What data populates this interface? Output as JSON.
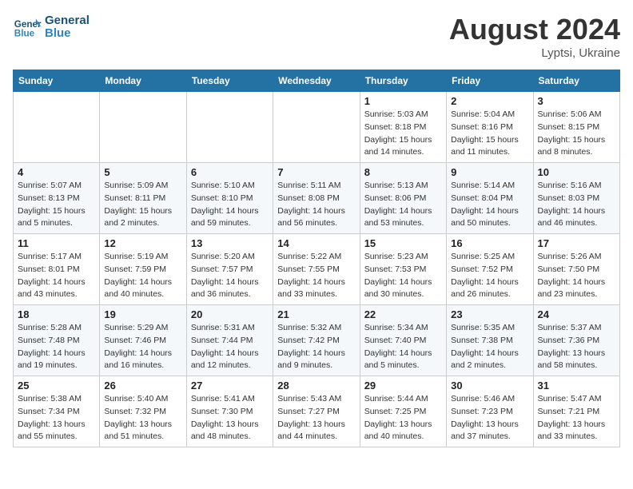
{
  "header": {
    "logo_general": "General",
    "logo_blue": "Blue",
    "month_year": "August 2024",
    "location": "Lyptsi, Ukraine"
  },
  "weekdays": [
    "Sunday",
    "Monday",
    "Tuesday",
    "Wednesday",
    "Thursday",
    "Friday",
    "Saturday"
  ],
  "weeks": [
    [
      {
        "day": "",
        "info": ""
      },
      {
        "day": "",
        "info": ""
      },
      {
        "day": "",
        "info": ""
      },
      {
        "day": "",
        "info": ""
      },
      {
        "day": "1",
        "info": "Sunrise: 5:03 AM\nSunset: 8:18 PM\nDaylight: 15 hours\nand 14 minutes."
      },
      {
        "day": "2",
        "info": "Sunrise: 5:04 AM\nSunset: 8:16 PM\nDaylight: 15 hours\nand 11 minutes."
      },
      {
        "day": "3",
        "info": "Sunrise: 5:06 AM\nSunset: 8:15 PM\nDaylight: 15 hours\nand 8 minutes."
      }
    ],
    [
      {
        "day": "4",
        "info": "Sunrise: 5:07 AM\nSunset: 8:13 PM\nDaylight: 15 hours\nand 5 minutes."
      },
      {
        "day": "5",
        "info": "Sunrise: 5:09 AM\nSunset: 8:11 PM\nDaylight: 15 hours\nand 2 minutes."
      },
      {
        "day": "6",
        "info": "Sunrise: 5:10 AM\nSunset: 8:10 PM\nDaylight: 14 hours\nand 59 minutes."
      },
      {
        "day": "7",
        "info": "Sunrise: 5:11 AM\nSunset: 8:08 PM\nDaylight: 14 hours\nand 56 minutes."
      },
      {
        "day": "8",
        "info": "Sunrise: 5:13 AM\nSunset: 8:06 PM\nDaylight: 14 hours\nand 53 minutes."
      },
      {
        "day": "9",
        "info": "Sunrise: 5:14 AM\nSunset: 8:04 PM\nDaylight: 14 hours\nand 50 minutes."
      },
      {
        "day": "10",
        "info": "Sunrise: 5:16 AM\nSunset: 8:03 PM\nDaylight: 14 hours\nand 46 minutes."
      }
    ],
    [
      {
        "day": "11",
        "info": "Sunrise: 5:17 AM\nSunset: 8:01 PM\nDaylight: 14 hours\nand 43 minutes."
      },
      {
        "day": "12",
        "info": "Sunrise: 5:19 AM\nSunset: 7:59 PM\nDaylight: 14 hours\nand 40 minutes."
      },
      {
        "day": "13",
        "info": "Sunrise: 5:20 AM\nSunset: 7:57 PM\nDaylight: 14 hours\nand 36 minutes."
      },
      {
        "day": "14",
        "info": "Sunrise: 5:22 AM\nSunset: 7:55 PM\nDaylight: 14 hours\nand 33 minutes."
      },
      {
        "day": "15",
        "info": "Sunrise: 5:23 AM\nSunset: 7:53 PM\nDaylight: 14 hours\nand 30 minutes."
      },
      {
        "day": "16",
        "info": "Sunrise: 5:25 AM\nSunset: 7:52 PM\nDaylight: 14 hours\nand 26 minutes."
      },
      {
        "day": "17",
        "info": "Sunrise: 5:26 AM\nSunset: 7:50 PM\nDaylight: 14 hours\nand 23 minutes."
      }
    ],
    [
      {
        "day": "18",
        "info": "Sunrise: 5:28 AM\nSunset: 7:48 PM\nDaylight: 14 hours\nand 19 minutes."
      },
      {
        "day": "19",
        "info": "Sunrise: 5:29 AM\nSunset: 7:46 PM\nDaylight: 14 hours\nand 16 minutes."
      },
      {
        "day": "20",
        "info": "Sunrise: 5:31 AM\nSunset: 7:44 PM\nDaylight: 14 hours\nand 12 minutes."
      },
      {
        "day": "21",
        "info": "Sunrise: 5:32 AM\nSunset: 7:42 PM\nDaylight: 14 hours\nand 9 minutes."
      },
      {
        "day": "22",
        "info": "Sunrise: 5:34 AM\nSunset: 7:40 PM\nDaylight: 14 hours\nand 5 minutes."
      },
      {
        "day": "23",
        "info": "Sunrise: 5:35 AM\nSunset: 7:38 PM\nDaylight: 14 hours\nand 2 minutes."
      },
      {
        "day": "24",
        "info": "Sunrise: 5:37 AM\nSunset: 7:36 PM\nDaylight: 13 hours\nand 58 minutes."
      }
    ],
    [
      {
        "day": "25",
        "info": "Sunrise: 5:38 AM\nSunset: 7:34 PM\nDaylight: 13 hours\nand 55 minutes."
      },
      {
        "day": "26",
        "info": "Sunrise: 5:40 AM\nSunset: 7:32 PM\nDaylight: 13 hours\nand 51 minutes."
      },
      {
        "day": "27",
        "info": "Sunrise: 5:41 AM\nSunset: 7:30 PM\nDaylight: 13 hours\nand 48 minutes."
      },
      {
        "day": "28",
        "info": "Sunrise: 5:43 AM\nSunset: 7:27 PM\nDaylight: 13 hours\nand 44 minutes."
      },
      {
        "day": "29",
        "info": "Sunrise: 5:44 AM\nSunset: 7:25 PM\nDaylight: 13 hours\nand 40 minutes."
      },
      {
        "day": "30",
        "info": "Sunrise: 5:46 AM\nSunset: 7:23 PM\nDaylight: 13 hours\nand 37 minutes."
      },
      {
        "day": "31",
        "info": "Sunrise: 5:47 AM\nSunset: 7:21 PM\nDaylight: 13 hours\nand 33 minutes."
      }
    ]
  ]
}
